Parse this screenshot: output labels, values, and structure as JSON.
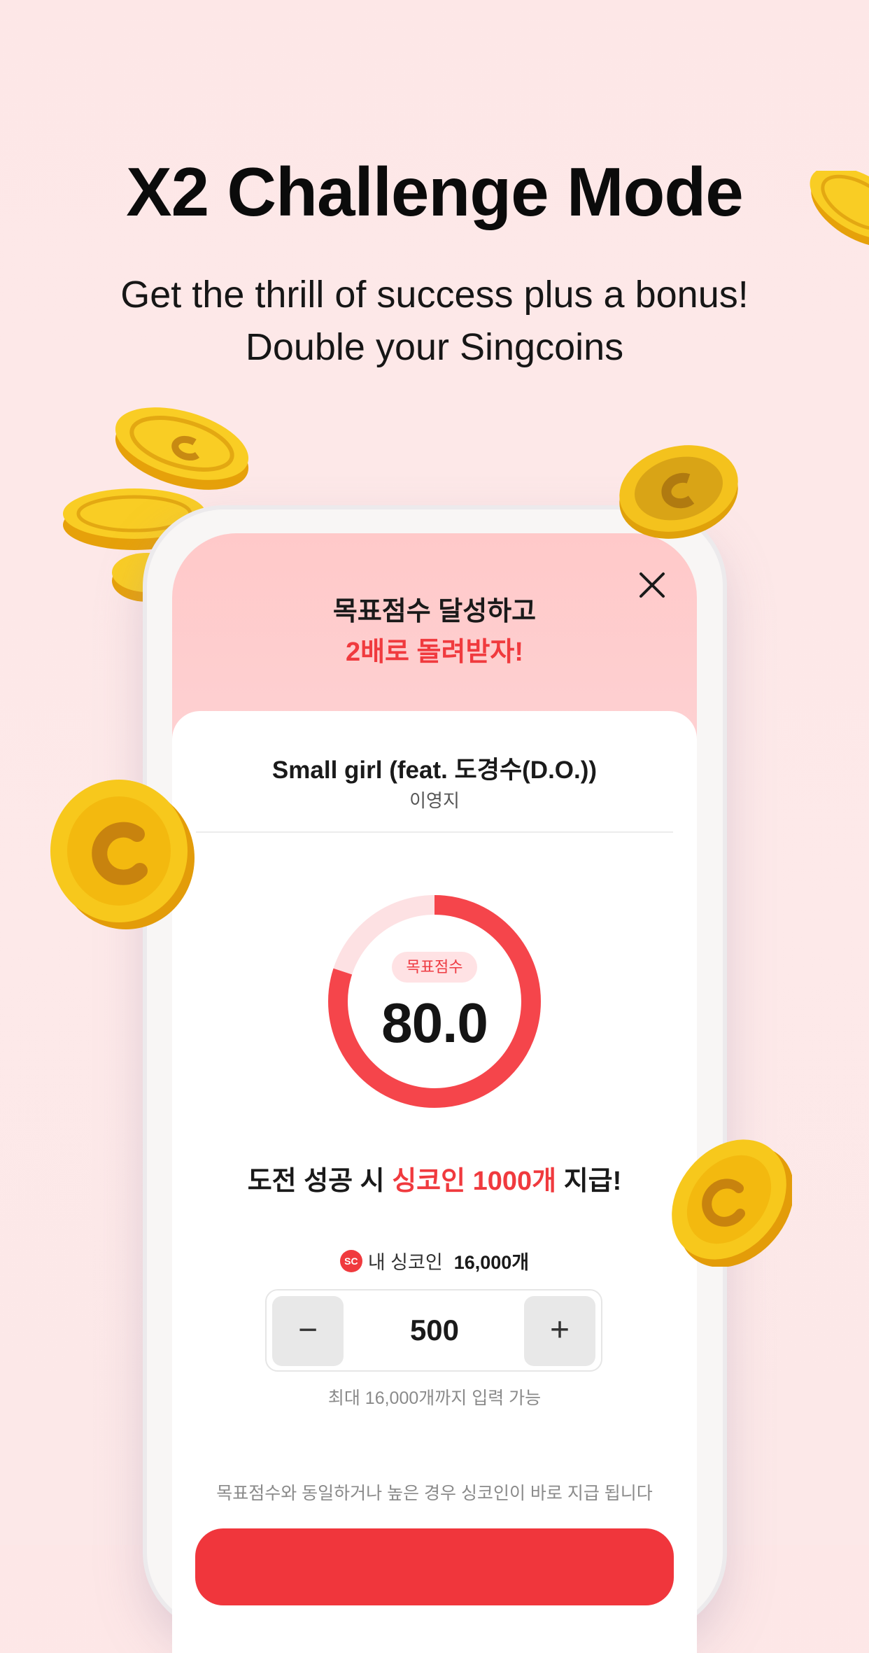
{
  "header": {
    "title": "X2 Challenge Mode",
    "subtitle_line1": "Get the thrill of success plus a bonus!",
    "subtitle_line2": "Double your Singcoins"
  },
  "modal": {
    "hero_line1": "목표점수 달성하고",
    "hero_line2": "2배로 돌려받자!",
    "song": {
      "title": "Small girl (feat. 도경수(D.O.))",
      "artist": "이영지"
    },
    "target": {
      "badge": "목표점수",
      "score": "80.0",
      "progress": 0.8
    },
    "reward": {
      "prefix": "도전 성공 시 ",
      "highlight": "싱코인 1000개",
      "suffix": " 지급!"
    },
    "wallet": {
      "icon_text": "SC",
      "label": "내 싱코인",
      "count": "16,000개"
    },
    "stepper": {
      "minus_glyph": "−",
      "value": "500",
      "plus_glyph": "+"
    },
    "max_note": "최대 16,000개까지 입력 가능",
    "bottom_note": "목표점수와 동일하거나 높은 경우 싱코인이 바로 지급 됩니다"
  },
  "colors": {
    "accent": "#f03a3e",
    "ring_track": "#fde1e3",
    "background": "#fde7e7",
    "coin": "#f6c21c"
  }
}
